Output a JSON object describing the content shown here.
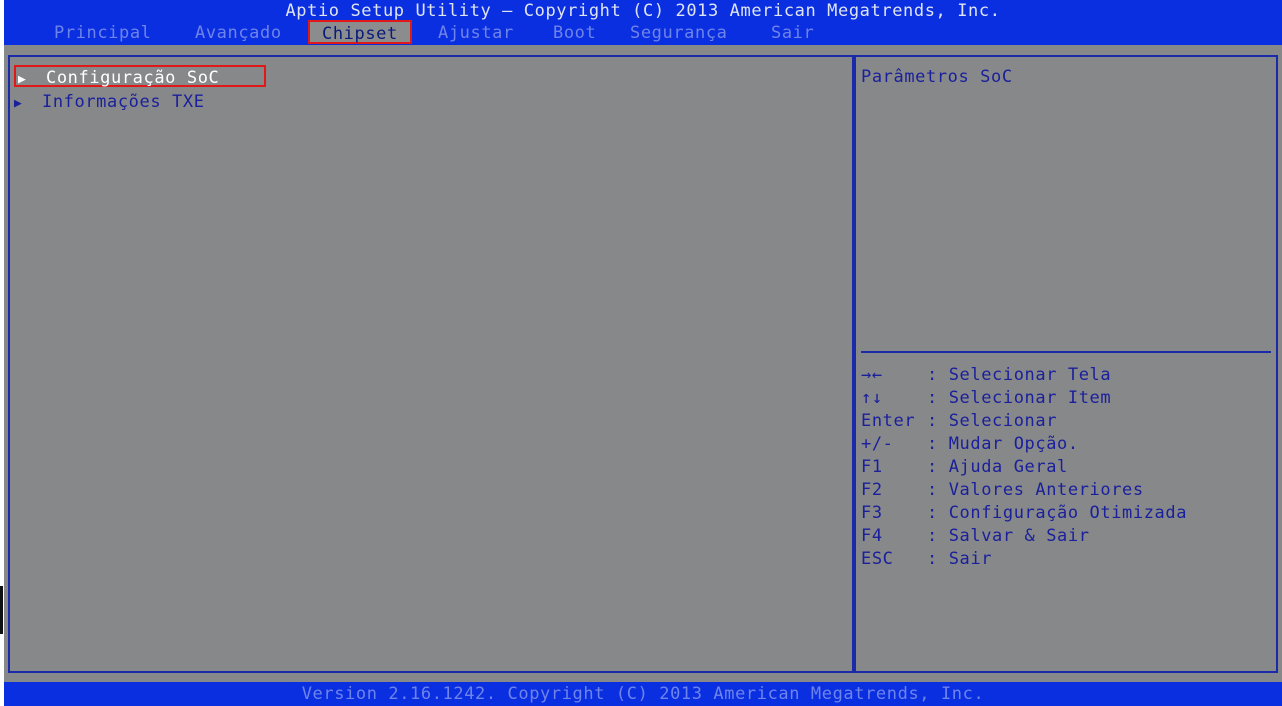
{
  "header": {
    "title": "Aptio Setup Utility – Copyright (C) 2013 American Megatrends, Inc.",
    "tabs": [
      {
        "label": "Principal"
      },
      {
        "label": "Avançado"
      },
      {
        "label": "Chipset",
        "active": true
      },
      {
        "label": "Ajustar"
      },
      {
        "label": "Boot"
      },
      {
        "label": "Segurança"
      },
      {
        "label": "Sair"
      }
    ]
  },
  "main": {
    "items": [
      {
        "label": "Configuração SoC",
        "selected": true,
        "icon": "triangle-right-icon"
      },
      {
        "label": "Informações TXE",
        "icon": "triangle-right-icon"
      }
    ]
  },
  "help": {
    "description": "Parâmetros SoC",
    "keys": [
      {
        "key": "→←",
        "sep": ":",
        "action": "Selecionar Tela"
      },
      {
        "key": "↑↓",
        "sep": ":",
        "action": "Selecionar Item"
      },
      {
        "key": "Enter",
        "sep": ":",
        "action": "Selecionar"
      },
      {
        "key": "+/-",
        "sep": ":",
        "action": "Mudar Opção."
      },
      {
        "key": "F1",
        "sep": ":",
        "action": "Ajuda Geral"
      },
      {
        "key": "F2",
        "sep": ":",
        "action": "Valores Anteriores"
      },
      {
        "key": "F3",
        "sep": ":",
        "action": "Configuração Otimizada"
      },
      {
        "key": "F4",
        "sep": ":",
        "action": "Salvar & Sair"
      },
      {
        "key": "ESC",
        "sep": ":",
        "action": "Sair"
      }
    ]
  },
  "footer": {
    "text": "Version 2.16.1242. Copyright (C) 2013 American Megatrends, Inc."
  },
  "colors": {
    "header_blue": "#0a2fe0",
    "panel_gray": "#868889",
    "text_blue": "#1a1f9c",
    "highlight_red": "#e01818"
  }
}
